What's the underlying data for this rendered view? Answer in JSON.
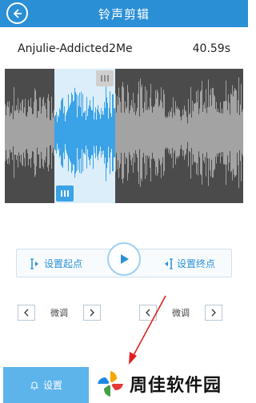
{
  "header": {
    "title": "铃声剪辑",
    "back_icon": "back-arrow-icon"
  },
  "track": {
    "name": "Anjulie-Addicted2Me",
    "duration": "40.59s"
  },
  "controls": {
    "set_start_label": "设置起点",
    "set_end_label": "设置终点",
    "play_icon": "play-icon",
    "start_icon": "set-start-icon",
    "end_icon": "set-end-icon"
  },
  "fine_tune": {
    "left_label": "微调",
    "right_label": "微调"
  },
  "bottom": {
    "set_label": "设置"
  },
  "watermark": {
    "text": "周佳软件园"
  },
  "colors": {
    "primary": "#2b8fd6",
    "selection": "#3aa2e6",
    "wave_dark_bg": "#4b4b4b",
    "wave_gray": "#a3a3a3",
    "annotation_red": "#e02020"
  }
}
